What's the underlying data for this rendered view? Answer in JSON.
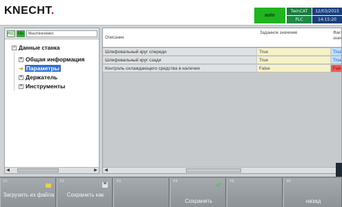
{
  "header": {
    "logo": "KNECHT",
    "logo_dot": ".",
    "mode": "auto",
    "status": [
      "TwinCAT",
      "12/03/2015",
      "PLC",
      "14:15:20"
    ]
  },
  "left": {
    "plc_btn": "PLC",
    "file_btn": "File",
    "input_value": "Maschinendaten",
    "tree": {
      "root": "Данные станка",
      "items": [
        "Общая информация",
        "Параметры",
        "Держатель",
        "Инструменты"
      ]
    }
  },
  "table": {
    "col_desc": "Описание",
    "col_default": "Заданное значение",
    "col_actual": "Фактическое значение",
    "rows": [
      {
        "desc": "Шлифовальный круг спереди",
        "default": "True",
        "actual": "True"
      },
      {
        "desc": "Шлифовальный круг сзади",
        "default": "True",
        "actual": "True"
      },
      {
        "desc": "Контроль охлаждающего средства в наличии",
        "default": "False",
        "actual": "False"
      }
    ]
  },
  "softkeys": [
    {
      "num": "F1",
      "label": "Загрузить из файла"
    },
    {
      "num": "F2",
      "label": "Сохранить как"
    },
    {
      "num": "F3",
      "label": ""
    },
    {
      "num": "F4",
      "label": "Сохранить"
    },
    {
      "num": "F5",
      "label": ""
    },
    {
      "num": "F6",
      "label": "назад"
    }
  ],
  "colors": {
    "accent": "#1fb51f",
    "selection": "#2f6fd6",
    "false": "#ef5a5a"
  }
}
